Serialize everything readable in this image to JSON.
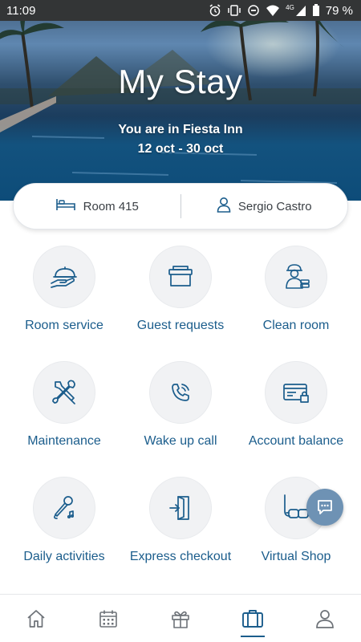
{
  "status_bar": {
    "time": "11:09",
    "battery": "79 %",
    "network": "4G",
    "icons": [
      "alarm-icon",
      "vibrate-icon",
      "do-not-disturb-icon",
      "wifi-icon",
      "signal-icon",
      "battery-icon"
    ]
  },
  "hero": {
    "title": "My Stay",
    "hotel_line": "You are in Fiesta Inn",
    "dates": "12 oct - 30 oct"
  },
  "info": {
    "room": "Room 415",
    "guest": "Sergio Castro"
  },
  "services": [
    {
      "label": "Room service",
      "icon": "room-service-icon"
    },
    {
      "label": "Guest requests",
      "icon": "guest-requests-icon"
    },
    {
      "label": "Clean room",
      "icon": "clean-room-icon"
    },
    {
      "label": "Maintenance",
      "icon": "maintenance-icon"
    },
    {
      "label": "Wake up call",
      "icon": "phone-icon"
    },
    {
      "label": "Account balance",
      "icon": "account-balance-icon"
    },
    {
      "label": "Daily activities",
      "icon": "microphone-icon"
    },
    {
      "label": "Express checkout",
      "icon": "checkout-icon"
    },
    {
      "label": "Virtual Shop",
      "icon": "snorkel-icon"
    }
  ],
  "bottom_nav": [
    {
      "icon": "home-icon",
      "active": false
    },
    {
      "icon": "calendar-icon",
      "active": false
    },
    {
      "icon": "gift-icon",
      "active": false
    },
    {
      "icon": "luggage-icon",
      "active": true
    },
    {
      "icon": "profile-icon",
      "active": false
    }
  ],
  "colors": {
    "accent": "#1b5d8c",
    "nav_inactive": "#6d7278",
    "tile_bg": "#f1f2f4",
    "chat_fab": "#6e92b4",
    "status_bar": "#333536"
  }
}
